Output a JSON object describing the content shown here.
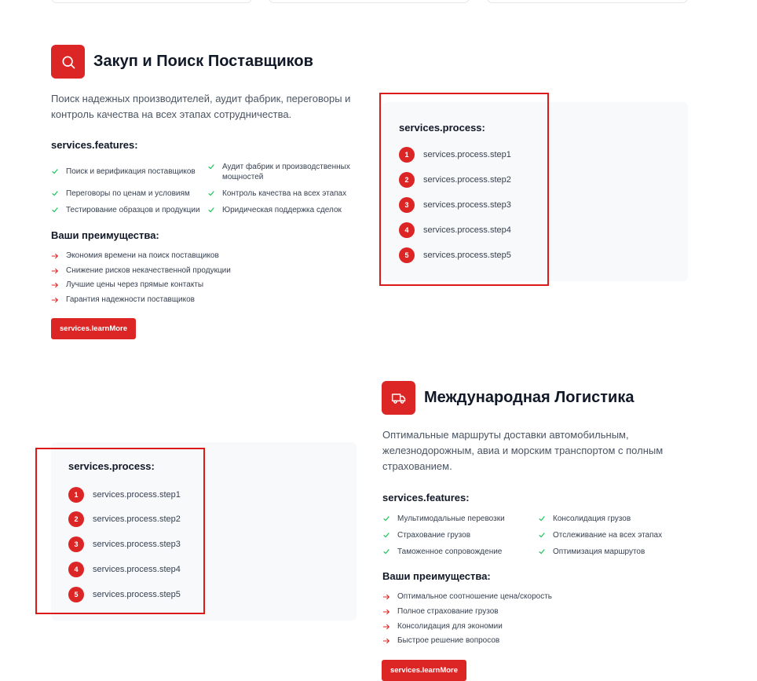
{
  "colors": {
    "accent": "#dc2626",
    "check": "#22c55e",
    "highlight": "#dc1a1a",
    "card_bg": "#f8f9fa"
  },
  "procurement": {
    "icon": "search-icon",
    "title": "Закуп и Поиск Поставщиков",
    "description": "Поиск надежных производителей, аудит фабрик, переговоры и контроль качества на всех этапах сотрудничества.",
    "features_heading": "services.features:",
    "features": [
      "Поиск и верификация поставщиков",
      "Аудит фабрик и производственных мощностей",
      "Переговоры по ценам и условиям",
      "Контроль качества на всех этапах",
      "Тестирование образцов и продукции",
      "Юридическая поддержка сделок"
    ],
    "advantages_heading": "Ваши преимущества:",
    "advantages": [
      "Экономия времени на поиск поставщиков",
      "Снижение рисков некачественной продукции",
      "Лучшие цены через прямые контакты",
      "Гарантия надежности поставщиков"
    ],
    "button": "services.learnMore",
    "process_heading": "services.process:",
    "steps": [
      {
        "num": "1",
        "label": "services.process.step1"
      },
      {
        "num": "2",
        "label": "services.process.step2"
      },
      {
        "num": "3",
        "label": "services.process.step3"
      },
      {
        "num": "4",
        "label": "services.process.step4"
      },
      {
        "num": "5",
        "label": "services.process.step5"
      }
    ]
  },
  "logistics": {
    "icon": "truck-icon",
    "title": "Международная Логистика",
    "description": "Оптимальные маршруты доставки автомобильным, железнодорожным, авиа и морским транспортом с полным страхованием.",
    "features_heading": "services.features:",
    "features": [
      "Мультимодальные перевозки",
      "Консолидация грузов",
      "Страхование грузов",
      "Отслеживание на всех этапах",
      "Таможенное сопровождение",
      "Оптимизация маршрутов"
    ],
    "advantages_heading": "Ваши преимущества:",
    "advantages": [
      "Оптимальное соотношение цена/скорость",
      "Полное страхование грузов",
      "Консолидация для экономии",
      "Быстрое решение вопросов"
    ],
    "button": "services.learnMore",
    "process_heading": "services.process:",
    "steps": [
      {
        "num": "1",
        "label": "services.process.step1"
      },
      {
        "num": "2",
        "label": "services.process.step2"
      },
      {
        "num": "3",
        "label": "services.process.step3"
      },
      {
        "num": "4",
        "label": "services.process.step4"
      },
      {
        "num": "5",
        "label": "services.process.step5"
      }
    ]
  }
}
